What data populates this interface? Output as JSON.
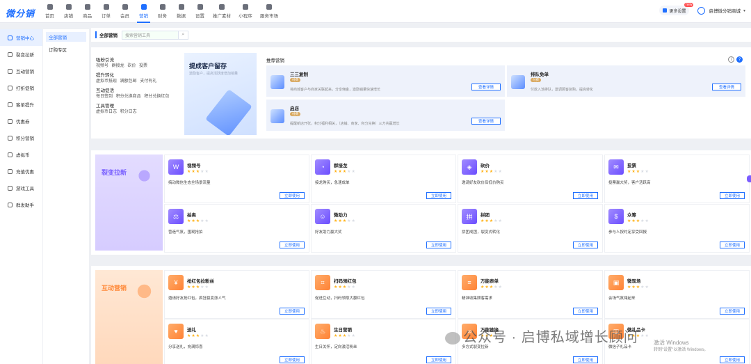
{
  "app": {
    "logo": "微分销"
  },
  "nav": [
    {
      "label": "首页",
      "icon": "home-icon"
    },
    {
      "label": "店铺",
      "icon": "store-icon"
    },
    {
      "label": "商品",
      "icon": "goods-icon"
    },
    {
      "label": "订单",
      "icon": "order-icon"
    },
    {
      "label": "会员",
      "icon": "member-icon"
    },
    {
      "label": "营销",
      "icon": "marketing-icon",
      "active": true
    },
    {
      "label": "财务",
      "icon": "finance-icon"
    },
    {
      "label": "数据",
      "icon": "data-icon"
    },
    {
      "label": "设置",
      "icon": "settings-icon"
    },
    {
      "label": "推广素材",
      "icon": "share-icon"
    },
    {
      "label": "小程序",
      "icon": "miniprogram-icon"
    },
    {
      "label": "服务市场",
      "icon": "service-market-icon"
    }
  ],
  "header": {
    "more_settings": "更多设置",
    "badge": "new",
    "shop_name": "启博微分销商城"
  },
  "sidebar": [
    {
      "label": "营销中心",
      "active": true
    },
    {
      "label": "裂变拉新"
    },
    {
      "label": "互动营销"
    },
    {
      "label": "打折促销"
    },
    {
      "label": "客单提升"
    },
    {
      "label": "优惠券"
    },
    {
      "label": "积分营销"
    },
    {
      "label": "虚拟币"
    },
    {
      "label": "充值优惠"
    },
    {
      "label": "游戏工具"
    },
    {
      "label": "群发助手"
    }
  ],
  "subsidebar": [
    {
      "label": "全部营销",
      "active": true
    },
    {
      "label": "订购专区"
    }
  ],
  "search": {
    "label": "全部营销",
    "placeholder": "搜索营销工具"
  },
  "categories": [
    {
      "title": "吸粉引流",
      "links": "视频号  群接龙  砍价  投票"
    },
    {
      "title": "提升转化",
      "links": "虚拟币抵现  满额包邮  支付有礼"
    },
    {
      "title": "互动促活",
      "links": "每日签到  积分兑换商品  积分兑换红包"
    },
    {
      "title": "工具管理",
      "links": "虚拟币日志  积分日志"
    }
  ],
  "banner": {
    "title": "提成客户留存",
    "subtitle": "激励客户，提高活跃度增加销量"
  },
  "recommend": {
    "title": "推荐营销",
    "cards": [
      {
        "name": "三三复制",
        "tag": "付费",
        "desc": "将商城客户与商家关联起来，分享佣金，激励销量快速增长",
        "button": "查看详情"
      },
      {
        "name": "排队免单",
        "tag": "付费",
        "desc": "付款入池排队，激调顾客复购，提高转化",
        "button": "查看详情"
      },
      {
        "name": "启店",
        "tag": "付费",
        "desc": "提醒新店开张，积分福利相关，（店铺、商家、积分兑换）三方共赢增长",
        "button": "查看详情"
      }
    ]
  },
  "section1": {
    "title": "裂变拉新",
    "tools": [
      {
        "name": "视频号",
        "glyph": "W",
        "stars": 3,
        "desc": "搞动微信生态全场景流量",
        "button": "立即使用"
      },
      {
        "name": "群接龙",
        "glyph": "◔",
        "stars": 3,
        "desc": "接龙购买，急速成单",
        "button": "立即使用"
      },
      {
        "name": "砍价",
        "glyph": "◈",
        "stars": 3,
        "desc": "邀请好友砍价后低价购买",
        "button": "立即使用"
      },
      {
        "name": "投票",
        "glyph": "✉",
        "stars": 3,
        "desc": "投票赢大奖，客户活跃高",
        "button": "立即使用"
      },
      {
        "name": "拍卖",
        "glyph": "⚖",
        "stars": 3,
        "desc": "营造气氛，围观抢拍",
        "button": "立即使用"
      },
      {
        "name": "微助力",
        "glyph": "☺",
        "stars": 3,
        "desc": "好友助力赢大奖",
        "button": "立即使用"
      },
      {
        "name": "拼团",
        "glyph": "拼",
        "stars": 3,
        "desc": "拼团成团，裂变式转化",
        "button": "立即使用"
      },
      {
        "name": "众筹",
        "glyph": "$",
        "stars": 3,
        "desc": "参与人按约定享受回报",
        "button": "立即使用"
      }
    ]
  },
  "section2": {
    "title": "互动营销",
    "tools": [
      {
        "name": "抢红包拉粉丝",
        "glyph": "¥",
        "stars": 3,
        "desc": "邀请好友抢红包，疯狂裂变涨人气",
        "button": "立即使用"
      },
      {
        "name": "扫码领红包",
        "glyph": "⌗",
        "stars": 3,
        "desc": "促进互动，扫码领取大额红包",
        "button": "立即使用"
      },
      {
        "name": "万能表单",
        "glyph": "≡",
        "stars": 3,
        "desc": "精准收集顾客需求",
        "button": "立即使用"
      },
      {
        "name": "微现场",
        "glyph": "▣",
        "stars": 3,
        "desc": "会场气氛嗨起来",
        "button": "立即使用"
      },
      {
        "name": "送礼",
        "glyph": "♥",
        "stars": 3,
        "desc": "分享送礼，充满惊喜",
        "button": "立即使用"
      },
      {
        "name": "生日营销",
        "glyph": "♨",
        "stars": 3,
        "desc": "生日关怀，定向激活粉丝",
        "button": "立即使用"
      },
      {
        "name": "万能链接",
        "glyph": "∞",
        "stars": 3,
        "desc": "多方式裂变拉新",
        "button": "立即使用"
      },
      {
        "name": "微礼品卡",
        "glyph": "◫",
        "stars": 3,
        "desc": "微信子礼品卡",
        "button": "立即使用"
      }
    ]
  },
  "overlay": {
    "watermark": "公众号 · 启博私域增长顾问",
    "win_line1": "激活 Windows",
    "win_line2": "转到\"设置\"以激活 Windows。"
  }
}
